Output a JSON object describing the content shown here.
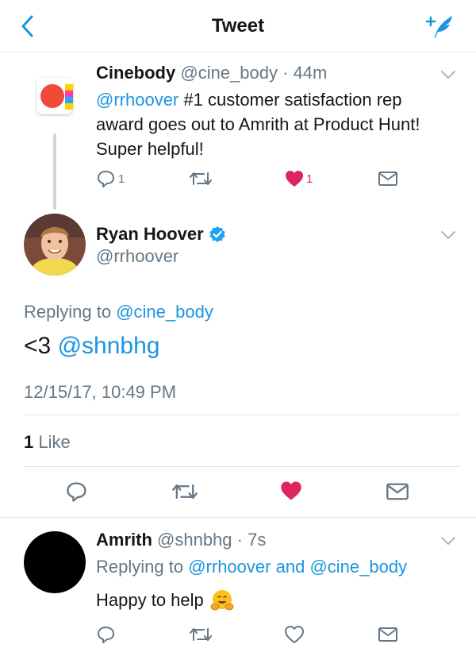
{
  "header": {
    "title": "Tweet",
    "back_icon": "back-chevron-icon",
    "compose_icon": "compose-tweet-icon"
  },
  "parent_tweet": {
    "name": "Cinebody",
    "handle": "@cine_body",
    "time": "44m",
    "mention": "@rrhoover",
    "text": "#1 customer satisfaction rep award goes out to Amrith at Product Hunt! Super helpful!",
    "reply_count": "1",
    "like_count": "1",
    "liked": true
  },
  "main_tweet": {
    "name": "Ryan Hoover",
    "handle": "@rrhoover",
    "verified": true,
    "replying_prefix": "Replying to",
    "replying_to": "@cine_body",
    "text": "<3",
    "mention": "@shnbhg",
    "timestamp": "12/15/17, 10:49 PM",
    "likes_count": "1",
    "likes_label": "Like",
    "liked": true
  },
  "reply_tweet": {
    "name": "Amrith",
    "handle": "@shnbhg",
    "time": "7s",
    "replying_prefix": "Replying to",
    "replying_to_1": "@rrhoover",
    "replying_and": "and",
    "replying_to_2": "@cine_body",
    "text": "Happy to help",
    "emoji": "hugging-face-emoji"
  },
  "colors": {
    "accent": "#1b95e0",
    "like": "#e0245e",
    "secondary_text": "#657786",
    "divider": "#e1e8ed"
  }
}
